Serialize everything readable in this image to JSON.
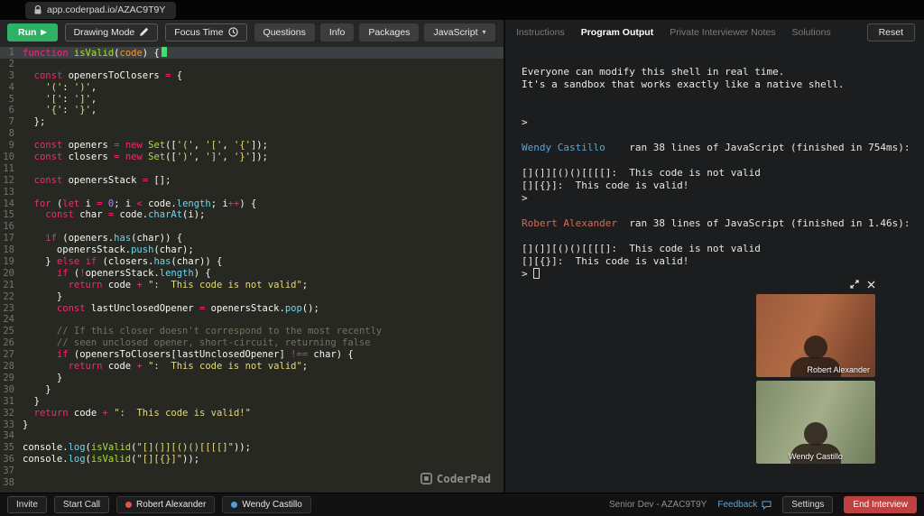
{
  "browser": {
    "url": "app.coderpad.io/AZAC9T9Y"
  },
  "toolbar": {
    "run_label": "Run",
    "drawing_mode_label": "Drawing Mode",
    "focus_time_label": "Focus Time",
    "questions_label": "Questions",
    "info_label": "Info",
    "packages_label": "Packages",
    "language_label": "JavaScript"
  },
  "output_panel": {
    "tabs": [
      {
        "label": "Instructions",
        "active": false
      },
      {
        "label": "Program Output",
        "active": true
      },
      {
        "label": "Private Interviewer Notes",
        "active": false
      },
      {
        "label": "Solutions",
        "active": false
      }
    ],
    "reset_label": "Reset"
  },
  "editor": {
    "logo": "CoderPad",
    "language": "JavaScript",
    "lines": [
      {
        "hl": true,
        "s": [
          [
            "kw",
            "function"
          ],
          [
            "pl",
            " "
          ],
          [
            "fn",
            "isValid"
          ],
          [
            "pl",
            "("
          ],
          [
            "arg",
            "code"
          ],
          [
            "pl",
            ") {"
          ],
          [
            "cur",
            ""
          ]
        ]
      },
      {
        "s": []
      },
      {
        "s": [
          [
            "pl",
            "  "
          ],
          [
            "kw",
            "const"
          ],
          [
            "pl",
            " openersToClosers "
          ],
          [
            "kw",
            "="
          ],
          [
            "pl",
            " {"
          ]
        ]
      },
      {
        "s": [
          [
            "pl",
            "    "
          ],
          [
            "str",
            "'('"
          ],
          [
            "pl",
            ": "
          ],
          [
            "str",
            "')'"
          ],
          [
            "pl",
            ","
          ]
        ]
      },
      {
        "s": [
          [
            "pl",
            "    "
          ],
          [
            "str",
            "'['"
          ],
          [
            "pl",
            ": "
          ],
          [
            "str",
            "']'"
          ],
          [
            "pl",
            ","
          ]
        ]
      },
      {
        "s": [
          [
            "pl",
            "    "
          ],
          [
            "str",
            "'{'"
          ],
          [
            "pl",
            ": "
          ],
          [
            "str",
            "'}'"
          ],
          [
            "pl",
            ","
          ]
        ]
      },
      {
        "s": [
          [
            "pl",
            "  };"
          ]
        ]
      },
      {
        "s": []
      },
      {
        "s": [
          [
            "pl",
            "  "
          ],
          [
            "kw",
            "const"
          ],
          [
            "pl",
            " openers "
          ],
          [
            "kw",
            "="
          ],
          [
            "pl",
            " "
          ],
          [
            "kw",
            "new"
          ],
          [
            "pl",
            " "
          ],
          [
            "fn",
            "Set"
          ],
          [
            "pl",
            "(["
          ],
          [
            "str",
            "'('"
          ],
          [
            "pl",
            ", "
          ],
          [
            "str",
            "'['"
          ],
          [
            "pl",
            ", "
          ],
          [
            "str",
            "'{'"
          ],
          [
            "pl",
            "]);"
          ]
        ]
      },
      {
        "s": [
          [
            "pl",
            "  "
          ],
          [
            "kw",
            "const"
          ],
          [
            "pl",
            " closers "
          ],
          [
            "kw",
            "="
          ],
          [
            "pl",
            " "
          ],
          [
            "kw",
            "new"
          ],
          [
            "pl",
            " "
          ],
          [
            "fn",
            "Set"
          ],
          [
            "pl",
            "(["
          ],
          [
            "str",
            "')'"
          ],
          [
            "pl",
            ", "
          ],
          [
            "str",
            "']'"
          ],
          [
            "pl",
            ", "
          ],
          [
            "str",
            "'}'"
          ],
          [
            "pl",
            "]);"
          ]
        ]
      },
      {
        "s": []
      },
      {
        "s": [
          [
            "pl",
            "  "
          ],
          [
            "kw",
            "const"
          ],
          [
            "pl",
            " openersStack "
          ],
          [
            "kw",
            "="
          ],
          [
            "pl",
            " [];"
          ]
        ]
      },
      {
        "s": []
      },
      {
        "s": [
          [
            "pl",
            "  "
          ],
          [
            "kw",
            "for"
          ],
          [
            "pl",
            " ("
          ],
          [
            "kw",
            "let"
          ],
          [
            "pl",
            " i "
          ],
          [
            "kw",
            "="
          ],
          [
            "pl",
            " "
          ],
          [
            "num",
            "0"
          ],
          [
            "pl",
            "; i "
          ],
          [
            "kw",
            "<"
          ],
          [
            "pl",
            " code."
          ],
          [
            "mth",
            "length"
          ],
          [
            "pl",
            "; i"
          ],
          [
            "kw",
            "++"
          ],
          [
            "pl",
            ") {"
          ]
        ]
      },
      {
        "s": [
          [
            "pl",
            "    "
          ],
          [
            "kw",
            "const"
          ],
          [
            "pl",
            " char "
          ],
          [
            "kw",
            "="
          ],
          [
            "pl",
            " code."
          ],
          [
            "mth",
            "charAt"
          ],
          [
            "pl",
            "(i);"
          ]
        ]
      },
      {
        "s": []
      },
      {
        "s": [
          [
            "pl",
            "    "
          ],
          [
            "kw",
            "if"
          ],
          [
            "pl",
            " (openers."
          ],
          [
            "mth",
            "has"
          ],
          [
            "pl",
            "(char)) {"
          ]
        ]
      },
      {
        "s": [
          [
            "pl",
            "      openersStack."
          ],
          [
            "mth",
            "push"
          ],
          [
            "pl",
            "(char);"
          ]
        ]
      },
      {
        "s": [
          [
            "pl",
            "    } "
          ],
          [
            "kw",
            "else"
          ],
          [
            "pl",
            " "
          ],
          [
            "kw",
            "if"
          ],
          [
            "pl",
            " (closers."
          ],
          [
            "mth",
            "has"
          ],
          [
            "pl",
            "(char)) {"
          ]
        ]
      },
      {
        "s": [
          [
            "pl",
            "      "
          ],
          [
            "kw",
            "if"
          ],
          [
            "pl",
            " ("
          ],
          [
            "kw",
            "!"
          ],
          [
            "pl",
            "openersStack."
          ],
          [
            "mth",
            "length"
          ],
          [
            "pl",
            ") {"
          ]
        ]
      },
      {
        "s": [
          [
            "pl",
            "        "
          ],
          [
            "kw",
            "return"
          ],
          [
            "pl",
            " code "
          ],
          [
            "kw",
            "+"
          ],
          [
            "pl",
            " "
          ],
          [
            "str",
            "\":  This code is not valid\""
          ],
          [
            "pl",
            ";"
          ]
        ]
      },
      {
        "s": [
          [
            "pl",
            "      }"
          ]
        ]
      },
      {
        "s": [
          [
            "pl",
            "      "
          ],
          [
            "kw",
            "const"
          ],
          [
            "pl",
            " lastUnclosedOpener "
          ],
          [
            "kw",
            "="
          ],
          [
            "pl",
            " openersStack."
          ],
          [
            "mth",
            "pop"
          ],
          [
            "pl",
            "();"
          ]
        ]
      },
      {
        "s": []
      },
      {
        "s": [
          [
            "cm",
            "      // If this closer doesn't correspond to the most recently"
          ]
        ]
      },
      {
        "s": [
          [
            "cm",
            "      // seen unclosed opener, short-circuit, returning false"
          ]
        ]
      },
      {
        "s": [
          [
            "pl",
            "      "
          ],
          [
            "kw",
            "if"
          ],
          [
            "pl",
            " (openersToClosers[lastUnclosedOpener] "
          ],
          [
            "kw",
            "!=="
          ],
          [
            "pl",
            " char) {"
          ]
        ]
      },
      {
        "s": [
          [
            "pl",
            "        "
          ],
          [
            "kw",
            "return"
          ],
          [
            "pl",
            " code "
          ],
          [
            "kw",
            "+"
          ],
          [
            "pl",
            " "
          ],
          [
            "str",
            "\":  This code is not valid\""
          ],
          [
            "pl",
            ";"
          ]
        ]
      },
      {
        "s": [
          [
            "pl",
            "      }"
          ]
        ]
      },
      {
        "s": [
          [
            "pl",
            "    }"
          ]
        ]
      },
      {
        "s": [
          [
            "pl",
            "  }"
          ]
        ]
      },
      {
        "s": [
          [
            "pl",
            "  "
          ],
          [
            "kw",
            "return"
          ],
          [
            "pl",
            " code "
          ],
          [
            "kw",
            "+"
          ],
          [
            "pl",
            " "
          ],
          [
            "str",
            "\":  This code is valid!\""
          ]
        ]
      },
      {
        "s": [
          [
            "pl",
            "}"
          ]
        ]
      },
      {
        "s": []
      },
      {
        "s": [
          [
            "pl",
            "console."
          ],
          [
            "mth",
            "log"
          ],
          [
            "pl",
            "("
          ],
          [
            "fn",
            "isValid"
          ],
          [
            "pl",
            "("
          ],
          [
            "str",
            "\"[](]][()()[[[[]\""
          ],
          [
            "pl",
            "));"
          ]
        ]
      },
      {
        "s": [
          [
            "pl",
            "console."
          ],
          [
            "mth",
            "log"
          ],
          [
            "pl",
            "("
          ],
          [
            "fn",
            "isValid"
          ],
          [
            "pl",
            "("
          ],
          [
            "str",
            "\"[][{}]\""
          ],
          [
            "pl",
            "));"
          ]
        ]
      },
      {
        "s": []
      },
      {
        "s": []
      }
    ]
  },
  "console": {
    "lines": [
      {
        "s": [
          [
            "c_pl",
            "Everyone can modify this shell in real time."
          ]
        ]
      },
      {
        "s": [
          [
            "c_pl",
            "It's a sandbox that works exactly like a native shell."
          ]
        ]
      },
      {
        "s": []
      },
      {
        "s": []
      },
      {
        "s": [
          [
            "c_pl",
            ">"
          ]
        ]
      },
      {
        "s": []
      },
      {
        "s": [
          [
            "c_blue",
            "Wendy Castillo"
          ],
          [
            "c_pl",
            "    ran 38 lines of JavaScript (finished in 754ms):"
          ]
        ]
      },
      {
        "s": []
      },
      {
        "s": [
          [
            "c_pl",
            "[](]][()()[[[[]:  This code is not valid"
          ]
        ]
      },
      {
        "s": [
          [
            "c_pl",
            "[][{}]:  This code is valid!"
          ]
        ]
      },
      {
        "s": [
          [
            "c_pl",
            ">"
          ]
        ]
      },
      {
        "s": []
      },
      {
        "s": [
          [
            "c_red",
            "Robert Alexander"
          ],
          [
            "c_pl",
            "  ran 38 lines of JavaScript (finished in 1.46s):"
          ]
        ]
      },
      {
        "s": []
      },
      {
        "s": [
          [
            "c_pl",
            "[](]][()()[[[[]:  This code is not valid"
          ]
        ]
      },
      {
        "s": [
          [
            "c_pl",
            "[][{}]:  This code is valid!"
          ]
        ]
      },
      {
        "s": [
          [
            "c_pl",
            "> "
          ],
          [
            "tcur",
            ""
          ]
        ]
      }
    ]
  },
  "videos": {
    "tiles": [
      {
        "name": "Robert Alexander"
      },
      {
        "name": "Wendy Castillo"
      }
    ]
  },
  "footer": {
    "invite_label": "Invite",
    "start_call_label": "Start Call",
    "participants": [
      {
        "name": "Robert Alexander",
        "color": "#e0564a"
      },
      {
        "name": "Wendy Castillo",
        "color": "#4f9fd8"
      }
    ],
    "session_label": "Senior Dev - AZAC9T9Y",
    "feedback_label": "Feedback",
    "settings_label": "Settings",
    "end_interview_label": "End Interview"
  },
  "colors": {
    "run_green": "#2fb165",
    "end_red": "#bf4040",
    "participant_blue": "#58a6d6",
    "participant_red": "#d96a57",
    "remote_cursor_green": "#3fe06d"
  }
}
